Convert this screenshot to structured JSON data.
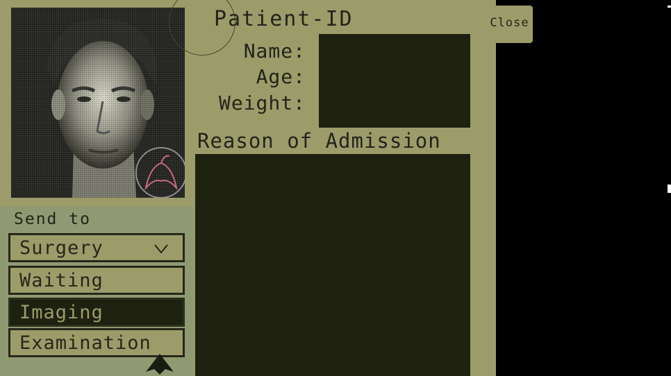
{
  "header": {
    "title": "Patient-ID",
    "close_label": "Close"
  },
  "patient_fields": {
    "name_label": "Name:",
    "age_label": "Age:",
    "weight_label": "Weight:"
  },
  "reason": {
    "label": "Reason of Admission"
  },
  "send_to": {
    "label": "Send to",
    "selected": "Surgery",
    "options": [
      "Waiting",
      "Imaging",
      "Examination"
    ]
  },
  "icons": {
    "dropdown": "chevron-down-icon",
    "cursor": "arrow-up-icon",
    "emblem": "eagle-emblem-icon"
  },
  "colors": {
    "panel": "#9c9c6a",
    "dark_field": "#1e2110",
    "send_panel": "#8f9a72",
    "text": "#22241a"
  }
}
